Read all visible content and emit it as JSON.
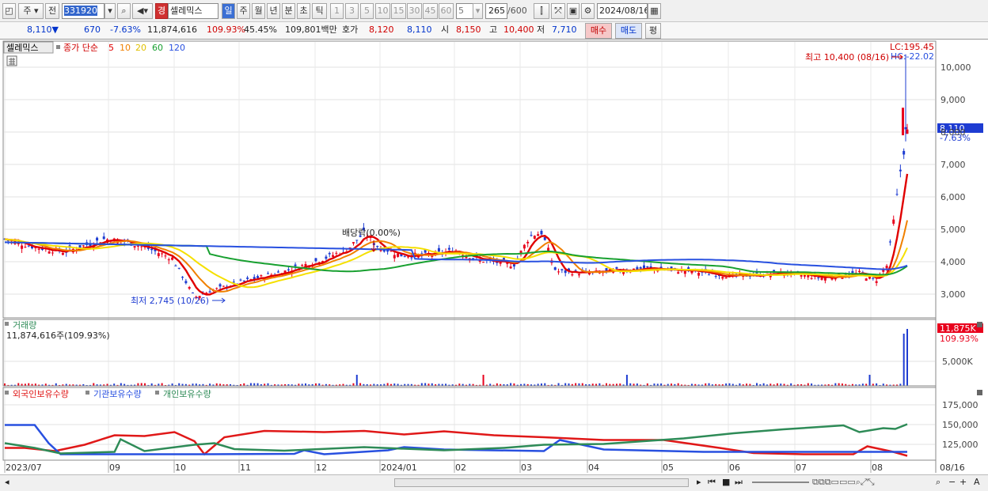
{
  "toolbar": {
    "mode": "주",
    "prev_label": "전",
    "stock_code": "331920",
    "stock_badge": "경",
    "stock_name": "셀레믹스",
    "periods": [
      "일",
      "주",
      "월",
      "년",
      "분",
      "초",
      "틱"
    ],
    "nums": [
      "1",
      "3",
      "5",
      "10",
      "15",
      "30",
      "45",
      "60"
    ],
    "count_sel": "5",
    "bar_count": "265",
    "bar_total": "/600",
    "date": "2024/08/16"
  },
  "quote": {
    "price": "8,110",
    "arrow": "▼",
    "change": "670",
    "change_pct": "-7.63%",
    "volume": "11,874,616",
    "vol_ratio": "109.93%",
    "turnover": "45.45%",
    "amount": "109,801백만",
    "hoga_label": "호가",
    "hoga1": "8,120",
    "hoga2": "8,110",
    "open_label": "시",
    "open": "8,150",
    "high_label": "고",
    "high": "10,400",
    "low_label": "저",
    "low": "7,710",
    "buy": "매수",
    "sell": "매도",
    "avg": "평"
  },
  "price_panel": {
    "name": "셀레믹스",
    "legend_title": "종가 단순",
    "ma_periods": [
      "5",
      "10",
      "20",
      "60",
      "120"
    ],
    "lc": "LC:195.45",
    "hc": "HC:-22.02",
    "high_annot": "최고 10,400 (08/16)",
    "low_annot": "최저 2,745 (10/26)",
    "dividend": "배당락(0.00%)",
    "cur_price": "8,110",
    "cur_change": "-7.63%",
    "y_ticks": [
      "10,000",
      "9,000",
      "8,000",
      "7,000",
      "6,000",
      "5,000",
      "4,000",
      "3,000"
    ]
  },
  "volume_panel": {
    "title": "거래량",
    "value": "11,874,616주(109.93%)",
    "badge": "11,875K",
    "badge_pct": "109.93%",
    "y_ticks": [
      "5,000K"
    ]
  },
  "holdings_panel": {
    "legend": [
      "외국인보유수량",
      "기관보유수량",
      "개인보유수량"
    ],
    "y_ticks": [
      "175,000",
      "150,000",
      "125,000"
    ]
  },
  "x_axis": {
    "labels": [
      "2023/07",
      "09",
      "10",
      "11",
      "12",
      "2024/01",
      "02",
      "03",
      "04",
      "05",
      "06",
      "07",
      "08"
    ],
    "last": "08/16"
  },
  "colors": {
    "up": "#e8001c",
    "down": "#1e3cd2",
    "ma5": "#e00000",
    "ma10": "#f08000",
    "ma20": "#f5e000",
    "ma60": "#18a030",
    "ma120": "#2850e0",
    "foreign": "#e01818",
    "inst": "#2850e0",
    "indiv": "#2e8b57"
  }
}
